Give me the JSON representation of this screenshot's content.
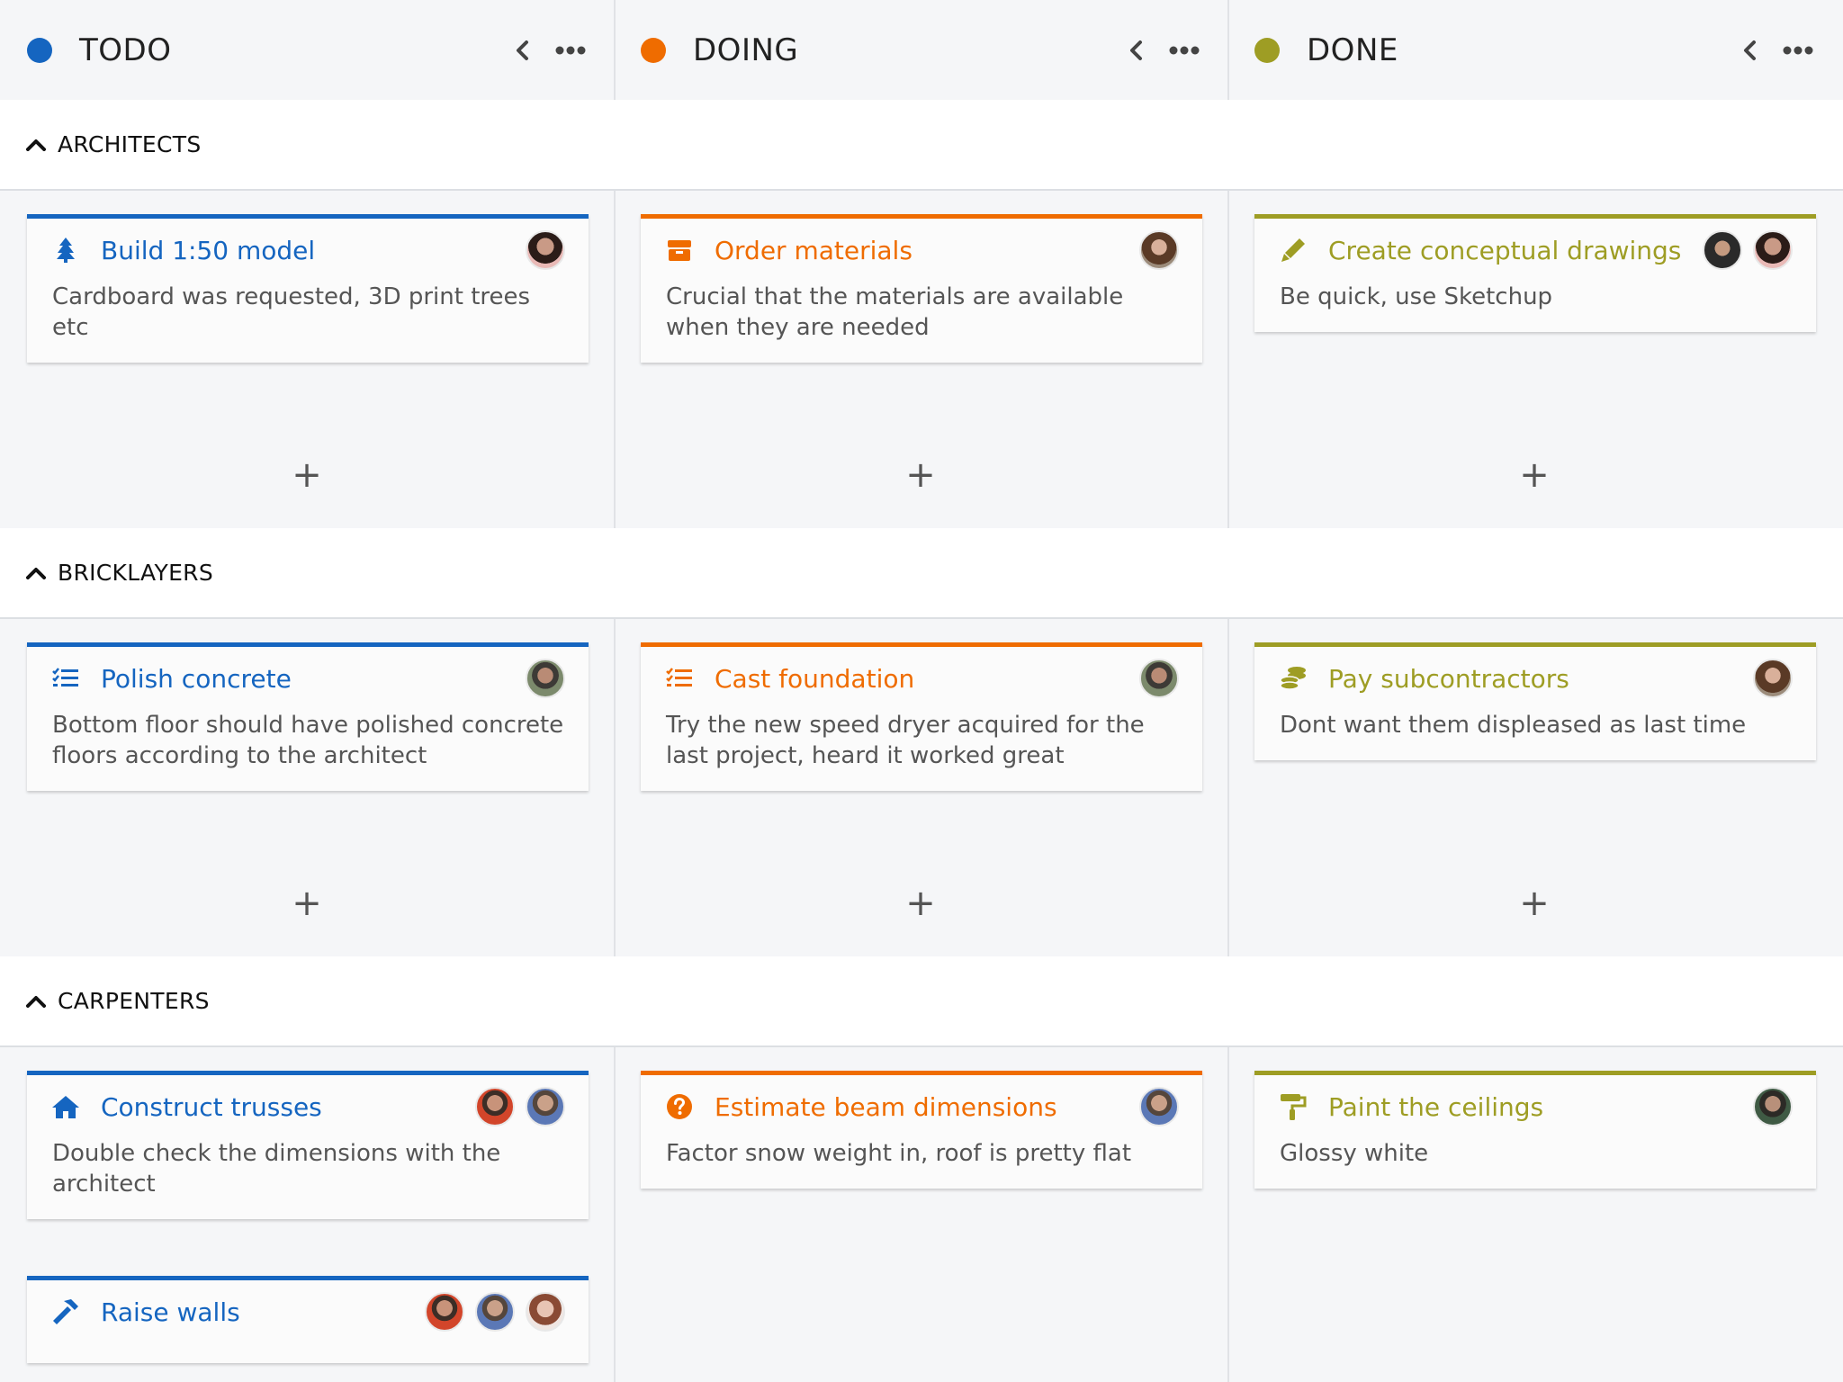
{
  "columns": [
    {
      "title": "TODO",
      "color": "#1565c0"
    },
    {
      "title": "DOING",
      "color": "#ef6c00"
    },
    {
      "title": "DONE",
      "color": "#9e9d24"
    }
  ],
  "lanes": [
    {
      "title": "ARCHITECTS"
    },
    {
      "title": "BRICKLAYERS"
    },
    {
      "title": "CARPENTERS"
    }
  ],
  "cards": [
    {
      "title": "Build 1:50 model",
      "desc": "Cardboard was requested, 3D print trees etc",
      "icon": "tree-icon",
      "avatars": [
        "avatar-woman-dark-hair"
      ]
    },
    {
      "title": "Order materials",
      "desc": "Crucial that the materials are available when they are needed",
      "icon": "box-icon",
      "avatars": [
        "avatar-woman-brown-hair"
      ]
    },
    {
      "title": "Create conceptual drawings",
      "desc": "Be quick, use Sketchup",
      "icon": "pen-icon",
      "avatars": [
        "avatar-man-dark",
        "avatar-woman-dark-hair"
      ]
    },
    {
      "title": "Polish concrete",
      "desc": "Bottom floor should have polished concrete floors according to the architect",
      "icon": "tasklist-icon",
      "avatars": [
        "avatar-man-outdoor"
      ]
    },
    {
      "title": "Cast foundation",
      "desc": "Try the new speed dryer acquired for the last project, heard it worked great",
      "icon": "tasklist-icon",
      "avatars": [
        "avatar-man-outdoor"
      ]
    },
    {
      "title": "Pay subcontractors",
      "desc": "Dont want them displeased as last time",
      "icon": "coins-icon",
      "avatars": [
        "avatar-woman-brown-hair"
      ]
    },
    {
      "title": "Construct trusses",
      "desc": "Double check the dimensions with the architect",
      "icon": "home-icon",
      "avatars": [
        "avatar-man-red-shirt",
        "avatar-man-blue-shirt"
      ]
    },
    {
      "title": "Estimate beam dimensions",
      "desc": "Factor snow weight in, roof is pretty flat",
      "icon": "question-icon",
      "avatars": [
        "avatar-man-blue-shirt"
      ]
    },
    {
      "title": "Paint the ceilings",
      "desc": "Glossy white",
      "icon": "paint-roller-icon",
      "avatars": [
        "avatar-man-green"
      ]
    },
    {
      "title": "Raise walls",
      "desc": "",
      "icon": "hammer-icon",
      "avatars": [
        "avatar-man-red-shirt",
        "avatar-man-blue-shirt",
        "avatar-woman-light"
      ]
    }
  ],
  "add_label": "+"
}
